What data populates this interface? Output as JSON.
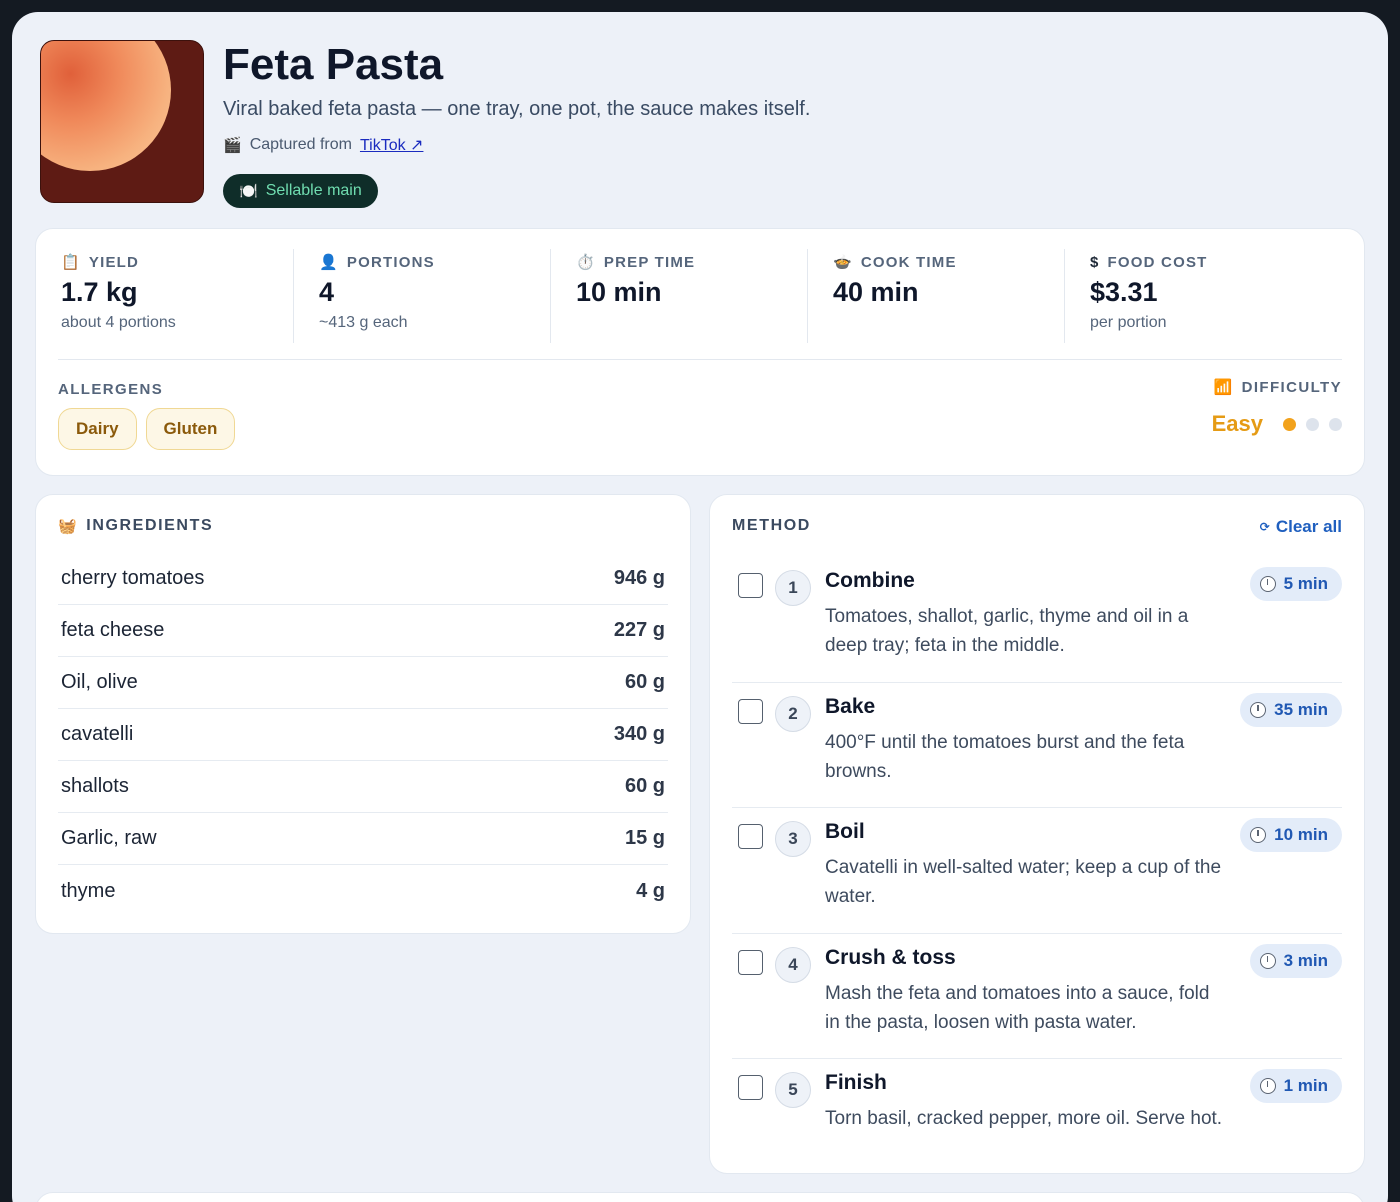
{
  "recipe": {
    "title": "Feta Pasta",
    "subtitle": "Viral baked feta pasta — one tray, one pot, the sauce makes itself.",
    "source_prefix": "Captured from",
    "source_link": "TikTok ↗",
    "source_icon": "clapperboard-icon",
    "category_badge": "Sellable main",
    "category_icon": "plate-icon"
  },
  "stats": [
    {
      "icon": "clipboard-icon",
      "label": "YIELD",
      "value": "1.7 kg",
      "sub": "about 4 portions"
    },
    {
      "icon": "person-icon",
      "label": "PORTIONS",
      "value": "4",
      "sub": "~413 g each"
    },
    {
      "icon": "stopwatch-icon",
      "label": "PREP TIME",
      "value": "10 min",
      "sub": ""
    },
    {
      "icon": "pot-icon",
      "label": "COOK TIME",
      "value": "40 min",
      "sub": ""
    },
    {
      "icon": "dollar-icon",
      "label": "FOOD COST",
      "value": "$3.31",
      "sub": "per portion"
    }
  ],
  "allergens": {
    "label": "ALLERGENS",
    "items": [
      "Dairy",
      "Gluten"
    ]
  },
  "difficulty": {
    "label": "DIFFICULTY",
    "icon": "bar-chart-icon",
    "value": "Easy",
    "level": 1,
    "max": 3,
    "color": "#f2a21c"
  },
  "ingredients": {
    "label": "INGREDIENTS",
    "icon": "basket-icon",
    "items": [
      {
        "name": "cherry tomatoes",
        "qty": "946 g"
      },
      {
        "name": "feta cheese",
        "qty": "227 g"
      },
      {
        "name": "Oil, olive",
        "qty": "60 g"
      },
      {
        "name": "cavatelli",
        "qty": "340 g"
      },
      {
        "name": "shallots",
        "qty": "60 g"
      },
      {
        "name": "Garlic, raw",
        "qty": "15 g"
      },
      {
        "name": "thyme",
        "qty": "4 g"
      }
    ]
  },
  "method": {
    "label": "METHOD",
    "clear_label": "Clear all",
    "clear_icon": "refresh-icon",
    "steps": [
      {
        "num": "1",
        "title": "Combine",
        "desc": "Tomatoes, shallot, garlic, thyme and oil in a deep tray; feta in the middle.",
        "time": "5 min",
        "checked": false
      },
      {
        "num": "2",
        "title": "Bake",
        "desc": "400°F until the tomatoes burst and the feta browns.",
        "time": "35 min",
        "checked": false
      },
      {
        "num": "3",
        "title": "Boil",
        "desc": "Cavatelli in well-salted water; keep a cup of the water.",
        "time": "10 min",
        "checked": false
      },
      {
        "num": "4",
        "title": "Crush & toss",
        "desc": "Mash the feta and tomatoes into a sauce, fold in the pasta, loosen with pasta water.",
        "time": "3 min",
        "checked": false
      },
      {
        "num": "5",
        "title": "Finish",
        "desc": "Torn basil, cracked pepper, more oil. Serve hot.",
        "time": "1 min",
        "checked": false
      }
    ]
  }
}
